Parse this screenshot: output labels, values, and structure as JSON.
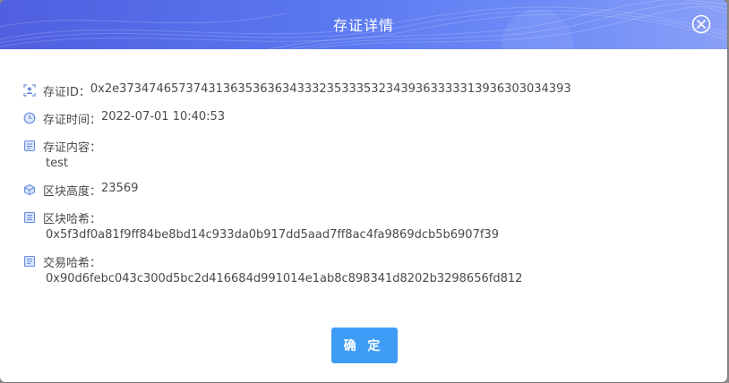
{
  "dialog": {
    "title": "存证详情",
    "confirm_label": "确 定"
  },
  "details": {
    "evidence_id_label": "存证ID：",
    "evidence_id_value": "0x2e3734746573743136353636343332353335323439363333313936303034393",
    "time_label": "存证时间：",
    "time_value": "2022-07-01 10:40:53",
    "content_label": "存证内容：",
    "content_value": "test",
    "height_label": "区块高度：",
    "height_value": "23569",
    "block_hash_label": "区块哈希：",
    "block_hash_value": "0x5f3df0a81f9ff84be8bd14c933da0b917dd5aad7ff8ac4fa9869dcb5b6907f39",
    "tx_hash_label": "交易哈希：",
    "tx_hash_value": "0x90d6febc043c300d5bc2d416684d991014e1ab8c898341d8202b3298656fd812"
  },
  "colors": {
    "header_start": "#4f5fe0",
    "header_end": "#8aa0f7",
    "button": "#3f9cf6",
    "icon": "#6b8de0"
  },
  "icons": [
    "id-card-icon",
    "clock-icon",
    "document-icon",
    "cube-icon",
    "block-hash-icon",
    "transaction-hash-icon",
    "close-icon"
  ]
}
